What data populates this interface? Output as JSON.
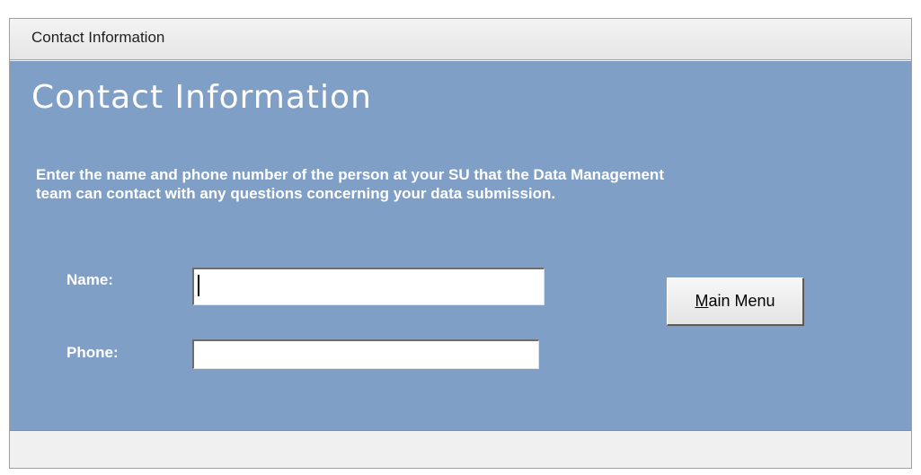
{
  "window": {
    "tab_caption": "Contact Information"
  },
  "form": {
    "header": "Contact Information",
    "instructions": "Enter the name and phone number of the person at your SU that the Data Management team can contact with any questions concerning your data submission.",
    "fields": {
      "name": {
        "label": "Name:",
        "value": ""
      },
      "phone": {
        "label": "Phone:",
        "value": ""
      }
    },
    "main_menu_button": {
      "mnemonic": "M",
      "rest": "ain Menu"
    }
  },
  "colors": {
    "form_background": "#7f9fc6",
    "label_text": "#ffffff",
    "window_chrome": "#ececec"
  }
}
